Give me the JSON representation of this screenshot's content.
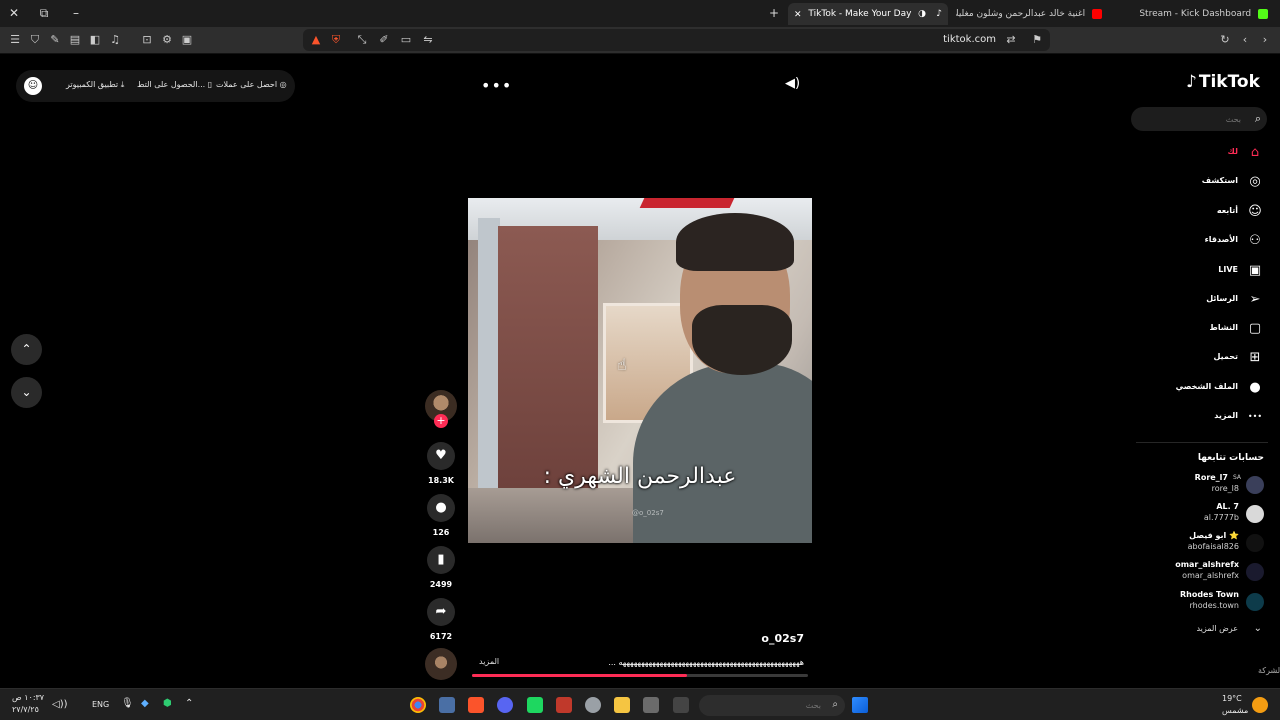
{
  "browser": {
    "window_controls": {
      "close": "✕",
      "new_window": "⧉",
      "minimize": "–",
      "new_tab": "+"
    },
    "tabs": [
      {
        "title": "TikTok - Make Your Day",
        "active": true,
        "favicon_color": "#ffffff"
      },
      {
        "title": "اغنية خالد عبدالرحمن وشلون مغليك - ...",
        "active": false,
        "favicon_color": "#ff0000"
      },
      {
        "title": "Stream - Kick Dashboard",
        "active": false,
        "favicon_color": "#53fc18"
      }
    ],
    "url": "tiktok.com"
  },
  "tiktok": {
    "logo": "TikTok",
    "search_placeholder": "بحث",
    "promo": {
      "get_coins": "احصل على عملات",
      "get_app": "الحصول على التط...",
      "pc_app": "تطبيق الكمبيوتر"
    },
    "nav": [
      {
        "label": "لك",
        "icon": "home-icon",
        "active": true
      },
      {
        "label": "استكشف",
        "icon": "compass-icon",
        "active": false
      },
      {
        "label": "أتابعه",
        "icon": "following-avatar-icon",
        "active": false
      },
      {
        "label": "الأصدقاء",
        "icon": "friends-icon",
        "active": false
      },
      {
        "label": "LIVE",
        "icon": "live-icon",
        "active": false
      },
      {
        "label": "الرسائل",
        "icon": "send-icon",
        "active": false
      },
      {
        "label": "النشاط",
        "icon": "activity-icon",
        "active": false
      },
      {
        "label": "تحميل",
        "icon": "upload-icon",
        "active": false
      },
      {
        "label": "الملف الشخصي",
        "icon": "profile-avatar-icon",
        "active": false
      },
      {
        "label": "المزيد",
        "icon": "more-icon",
        "active": false
      }
    ],
    "following_title": "حسابات تتابعها",
    "following": [
      {
        "name": "Rore_l7",
        "handle": "rore_l8",
        "badge": "SA",
        "color": "#3a3f5a"
      },
      {
        "name": "AL. 7",
        "handle": "al.7777b",
        "color": "#d9d9d9"
      },
      {
        "name": "ابو فيصل ⭐",
        "handle": "abofaisal826",
        "color": "#111111"
      },
      {
        "name": "omar_alshrefx",
        "handle": "omar_alshrefx",
        "color": "#1a1a2e"
      },
      {
        "name": "Rhodes Town",
        "handle": "rhodes.town",
        "color": "#0d3b4a"
      }
    ],
    "see_more": "عرض المزيد",
    "company_edge": "الشركة",
    "video": {
      "caption": "عبدالرحمن الشهري :",
      "watermark": "@o_02s7",
      "author": "o_02s7",
      "description": "هههههههههههههههههههههههههههههههههههههههههههههههههه ...",
      "more_label": "المزيد",
      "progress": 0.64
    },
    "stats": {
      "likes": "18.3K",
      "comments": "126",
      "saves": "2499",
      "shares": "6172"
    }
  },
  "taskbar": {
    "time": "١٠:٣٧ ص",
    "date": "٢٧/٧/٢٥",
    "language": "ENG",
    "search_placeholder": "بحث",
    "weather_temp": "19°C",
    "weather_desc": "مشمس"
  }
}
